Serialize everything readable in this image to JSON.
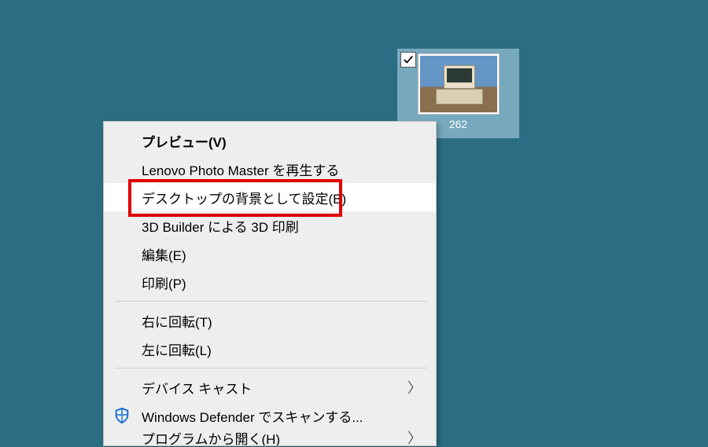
{
  "desktop": {
    "icon_label": "262"
  },
  "menu": {
    "items": [
      {
        "label": "プレビュー(V)",
        "bold": true
      },
      {
        "label": "Lenovo Photo Master を再生する"
      },
      {
        "label": "デスクトップの背景として設定(B)",
        "hover": true
      },
      {
        "label": "3D Builder による 3D 印刷"
      },
      {
        "label": "編集(E)"
      },
      {
        "label": "印刷(P)"
      },
      {
        "sep": true
      },
      {
        "label": "右に回転(T)"
      },
      {
        "label": "左に回転(L)"
      },
      {
        "sep": true
      },
      {
        "label": "デバイス キャスト",
        "submenu": true
      },
      {
        "label": "Windows Defender でスキャンする...",
        "icon": "defender"
      },
      {
        "label": "プログラムから開く(H)",
        "submenu": true,
        "cut": true
      }
    ]
  }
}
